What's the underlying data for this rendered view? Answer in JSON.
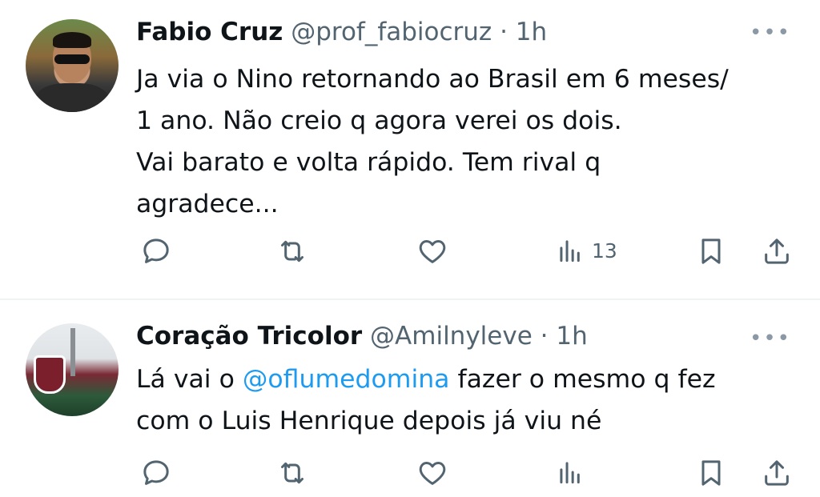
{
  "tweets": [
    {
      "name": "Fabio Cruz",
      "handle": "@prof_fabiocruz",
      "dot": "·",
      "time": "1h",
      "more": "•••",
      "lines": [
        "Ja via o Nino retornando ao Brasil em 6 meses/",
        "1 ano. Não creio q agora verei os dois.",
        "Vai barato e volta rápido. Tem rival q",
        "agradece..."
      ],
      "views": "13"
    },
    {
      "name": "Coração Tricolor",
      "handle": "@Amilnyleve",
      "dot": "·",
      "time": "1h",
      "more": "•••",
      "line1_before": "Lá vai o ",
      "mention": "@oflumedomina",
      "line1_after": " fazer o mesmo q fez",
      "line2": "com o Luis Henrique depois já viu né"
    }
  ],
  "icons": {
    "reply": "reply-icon",
    "retweet": "retweet-icon",
    "like": "like-icon",
    "views": "views-icon",
    "bookmark": "bookmark-icon",
    "share": "share-icon"
  },
  "colors": {
    "mention": "#1d9bf0",
    "secondary": "#536471",
    "divider": "#eff3f4"
  }
}
